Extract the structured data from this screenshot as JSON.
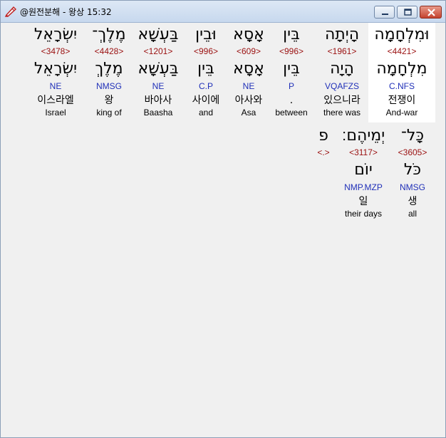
{
  "window": {
    "title": "@원전분해 - 왕상 15:32",
    "icon": "pen-icon",
    "buttons": [
      "minimize-icon",
      "maximize-icon",
      "close-icon"
    ]
  },
  "colors": {
    "strong": "#9a1010",
    "morph": "#2030b8",
    "selected_bg": "#ffffff"
  },
  "rows": [
    [
      {
        "heb": "וּמִלְחָמָה",
        "strong": "<4421>",
        "lemma": "מִלְחָמָה",
        "morph": "C.NFS",
        "ko": "전쟁이",
        "en": "And-war",
        "selected": true
      },
      {
        "heb": "הָיְתָה",
        "strong": "<1961>",
        "lemma": "הָיָה",
        "morph": "VQAFZS",
        "ko": "있으니라",
        "en": "there was"
      },
      {
        "heb": "בֵּין",
        "strong": "<996>",
        "lemma": "בֵּין",
        "morph": "P",
        "ko": ".",
        "en": "between"
      },
      {
        "heb": "אָסָא",
        "strong": "<609>",
        "lemma": "אָסָא",
        "morph": "NE",
        "ko": "아사와",
        "en": "Asa"
      },
      {
        "heb": "וּבֵין",
        "strong": "<996>",
        "lemma": "בֵּין",
        "morph": "C.P",
        "ko": "사이에",
        "en": "and"
      },
      {
        "heb": "בַּעְשָׁא",
        "strong": "<1201>",
        "lemma": "בַּעְשָׁא",
        "morph": "NE",
        "ko": "바아사",
        "en": "Baasha"
      },
      {
        "heb": "מֶלֶךְ־",
        "strong": "<4428>",
        "lemma": "מֶלֶךְ",
        "morph": "NMSG",
        "ko": "왕",
        "en": "king of"
      },
      {
        "heb": "יִשְׂרָאֵל",
        "strong": "<3478>",
        "lemma": "יִשְׂרָאֵל",
        "morph": "NE",
        "ko": "이스라엘",
        "en": "Israel"
      }
    ],
    [
      {
        "heb": "כָּל־",
        "strong": "<3605>",
        "lemma": "כֹּל",
        "morph": "NMSG",
        "ko": "생",
        "en": "all"
      },
      {
        "heb": "יְמֵיהֶם׃",
        "strong": "<3117>",
        "lemma": "יוֹם",
        "morph": "NMP.MZP",
        "ko": "일",
        "en": "their days"
      },
      {
        "heb": "פ",
        "strong": "<.>",
        "lemma": "",
        "morph": "",
        "ko": "",
        "en": ""
      }
    ]
  ]
}
